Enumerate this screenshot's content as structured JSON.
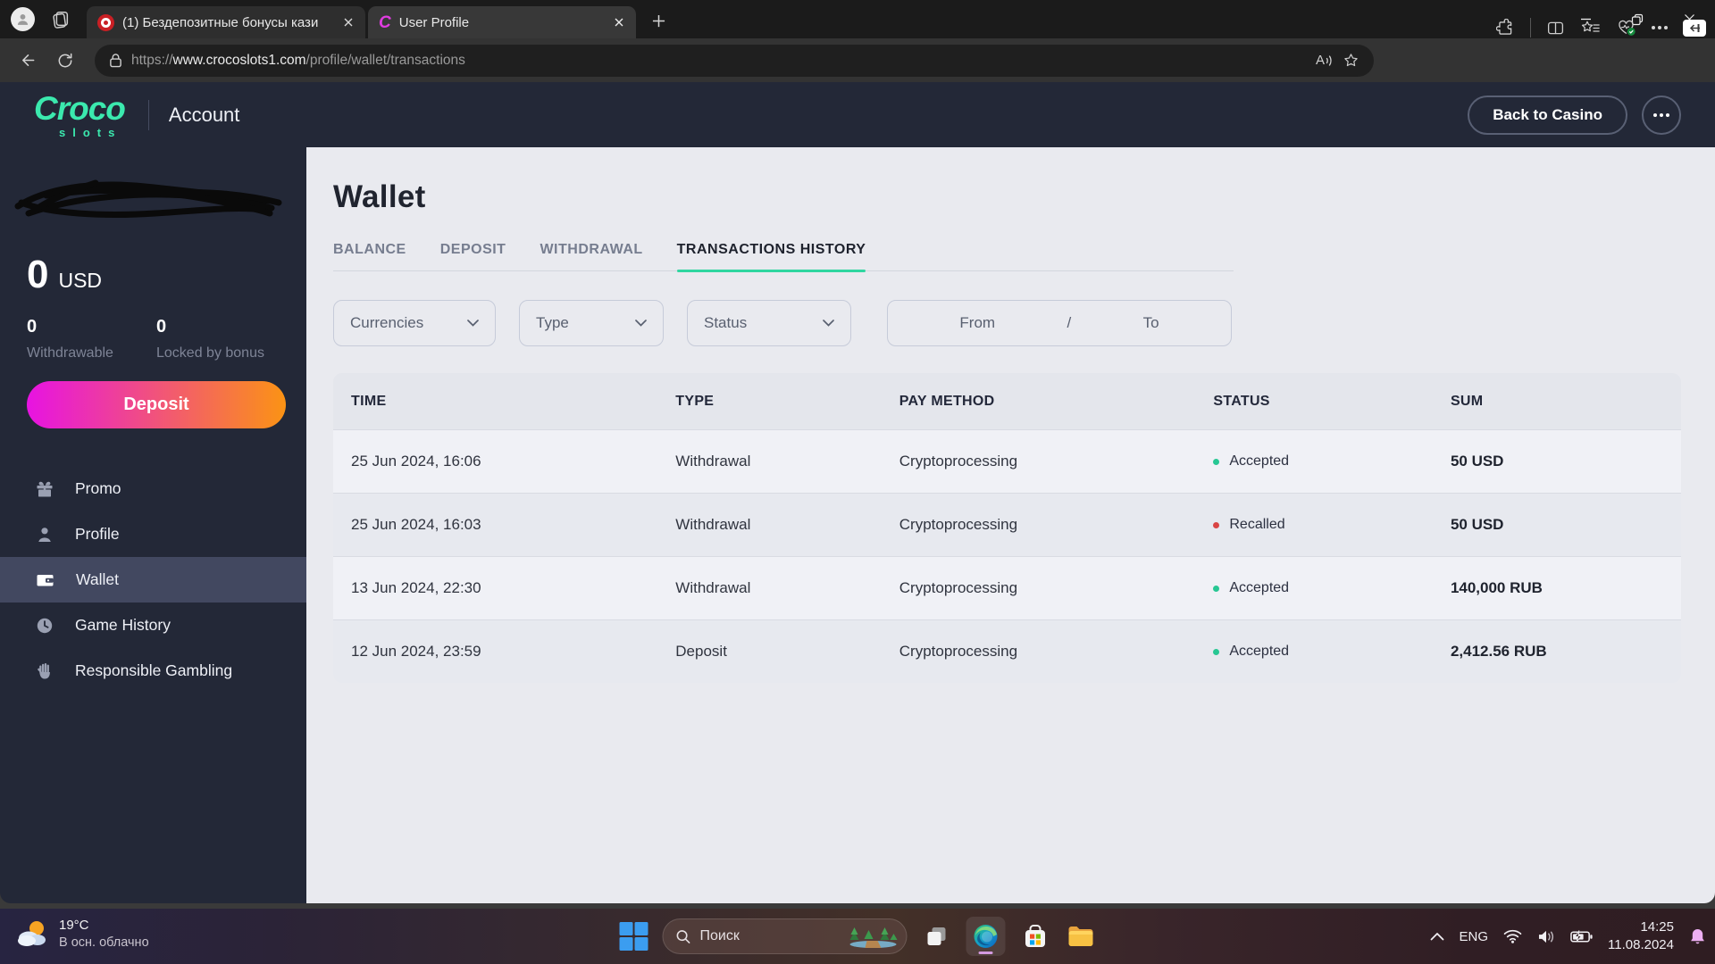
{
  "browser": {
    "tab_other": {
      "title": "(1) Бездепозитные бонусы кази"
    },
    "tab_active": {
      "title": "User Profile"
    },
    "address": {
      "scheme": "https://",
      "domain": "www.crocoslots1.com",
      "path": "/profile/wallet/transactions"
    },
    "read_aloud_glyph": "A"
  },
  "site": {
    "brand_name": "Croco",
    "brand_sub": "slots",
    "section_title": "Account",
    "back_button": "Back to Casino"
  },
  "wallet_summary": {
    "balance_amount": "0",
    "balance_currency": "USD",
    "withdrawable_value": "0",
    "withdrawable_label": "Withdrawable",
    "locked_value": "0",
    "locked_label": "Locked by bonus",
    "deposit_button": "Deposit"
  },
  "sidebar_menu": {
    "promo": "Promo",
    "profile": "Profile",
    "wallet": "Wallet",
    "game_history": "Game History",
    "responsible": "Responsible Gambling"
  },
  "main": {
    "title": "Wallet",
    "tabs": {
      "balance": "BALANCE",
      "deposit": "DEPOSIT",
      "withdrawal": "WITHDRAWAL",
      "transactions": "TRANSACTIONS HISTORY"
    },
    "filters": {
      "currencies": "Currencies",
      "type": "Type",
      "status": "Status",
      "from": "From",
      "slash": "/",
      "to": "To"
    },
    "table": {
      "headers": {
        "time": "TIME",
        "type": "TYPE",
        "pay_method": "PAY METHOD",
        "status": "STATUS",
        "sum": "SUM"
      },
      "rows": [
        {
          "time": "25 Jun 2024, 16:06",
          "type": "Withdrawal",
          "pay_method": "Cryptoprocessing",
          "status": "Accepted",
          "sum": "50 USD"
        },
        {
          "time": "25 Jun 2024, 16:03",
          "type": "Withdrawal",
          "pay_method": "Cryptoprocessing",
          "status": "Recalled",
          "sum": "50 USD"
        },
        {
          "time": "13 Jun 2024, 22:30",
          "type": "Withdrawal",
          "pay_method": "Cryptoprocessing",
          "status": "Accepted",
          "sum": "140,000 RUB"
        },
        {
          "time": "12 Jun 2024, 23:59",
          "type": "Deposit",
          "pay_method": "Cryptoprocessing",
          "status": "Accepted",
          "sum": "2,412.56 RUB"
        }
      ]
    }
  },
  "taskbar": {
    "weather_temp": "19°C",
    "weather_condition": "В осн. облачно",
    "search_label": "Поиск",
    "language": "ENG",
    "time": "14:25",
    "date": "11.08.2024"
  },
  "colors": {
    "accent_green": "#2fd6a0",
    "status_accepted": "#27c793",
    "status_recalled": "#d94545",
    "deposit_gradient_start": "#e713e2",
    "deposit_gradient_end": "#fb9314",
    "sidebar_navy": "#232837"
  }
}
